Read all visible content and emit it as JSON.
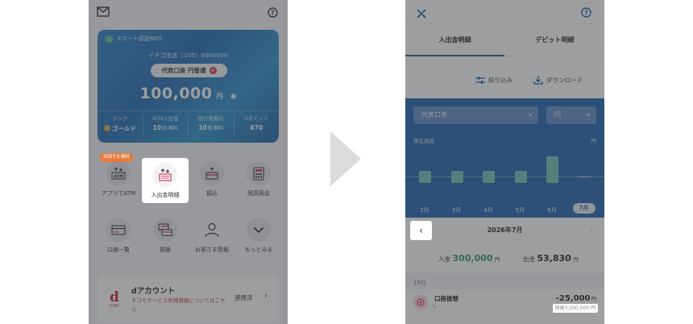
{
  "left": {
    "card": {
      "brand": "スマート認証NEO",
      "branch": "イチゴ支店（105）0000000",
      "account": "代表口座 円普通",
      "balance": "100,000",
      "yen": "円",
      "cols": [
        {
          "label": "ランク",
          "value": "ゴールド",
          "unit": ""
        },
        {
          "label": "ATM入出金",
          "value": "10",
          "unit": "回 無料"
        },
        {
          "label": "他行宛振込",
          "value": "10",
          "unit": "回 無料"
        },
        {
          "label": "dポイント",
          "value": "870",
          "unit": ""
        }
      ]
    },
    "badge": "何回でも無料",
    "menu": [
      {
        "label": "アプリでATM",
        "icon": "atm-icon"
      },
      {
        "label": "入出金明細",
        "icon": "statement-icon"
      },
      {
        "label": "振込",
        "icon": "transfer-icon"
      },
      {
        "label": "残高照会",
        "icon": "calculator-icon"
      },
      {
        "label": "口座一覧",
        "icon": "card-icon"
      },
      {
        "label": "振替",
        "icon": "exchange-icon"
      },
      {
        "label": "お客さま情報",
        "icon": "person-icon"
      },
      {
        "label": "もっとみる",
        "icon": "chevron-down-icon"
      }
    ],
    "dacct": {
      "title": "dアカウント",
      "subtitle": "ドコモサービス利用特典についてはこちら",
      "status": "連携済",
      "logo_text": "POINT"
    }
  },
  "right": {
    "tabs": [
      "入出金明細",
      "デビット明細"
    ],
    "tools": {
      "filter": "絞り込み",
      "download": "ダウンロード"
    },
    "select_account": "代表口座",
    "select_currency": "円",
    "chart_label": "現在残高",
    "chart_unit": "円",
    "month_nav": {
      "title": "2026年7月"
    },
    "summary": {
      "in_label": "入金",
      "in_value": "300,000",
      "in_unit": "円",
      "out_label": "出金",
      "out_value": "53,830",
      "out_unit": "円"
    },
    "tx_date": "19日",
    "tx": {
      "name": "口座振替",
      "amount": "-25,000",
      "unit": "円",
      "balance": "残高3,000,000 円"
    }
  },
  "chart_data": {
    "type": "bar",
    "categories": [
      "2月",
      "3月",
      "4月",
      "5月",
      "6月",
      "7月"
    ],
    "values": [
      1,
      1,
      1,
      1,
      2.2,
      0
    ],
    "title": "",
    "xlabel": "",
    "ylabel": "円"
  }
}
